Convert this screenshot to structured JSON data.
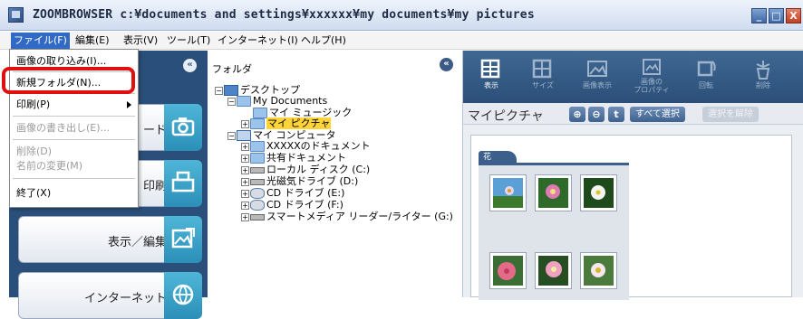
{
  "window": {
    "title": "ZOOMBROWSER c:¥documents and settings¥xxxxxx¥my documents¥my pictures",
    "minimize": "_",
    "maximize": "□",
    "close": "X"
  },
  "menubar": {
    "items": [
      "ファイル(F)",
      "編集(E)",
      "表示(V)",
      "ツール(T)",
      "インターネット(I)",
      "ヘルプ(H)"
    ]
  },
  "file_menu": {
    "items": [
      {
        "label": "画像の取り込み(I)...",
        "enabled": true
      },
      {
        "label": "新規フォルダ(N)...",
        "enabled": true,
        "highlighted": true
      },
      {
        "label": "印刷(P)",
        "enabled": true,
        "submenu": true
      },
      {
        "label": "画像の書き出し(E)...",
        "enabled": false
      },
      {
        "label": "削除(D)",
        "enabled": false
      },
      {
        "label": "名前の変更(M)",
        "enabled": false
      },
      {
        "label": "終了(X)",
        "enabled": true
      }
    ]
  },
  "task_pane": {
    "collapse": "«",
    "buttons": [
      {
        "label": "ード",
        "icon": "camera-icon"
      },
      {
        "label": "印刷",
        "icon": "printer-icon"
      },
      {
        "label": "表示／編集",
        "icon": "image-edit-icon"
      },
      {
        "label": "インターネット",
        "icon": "globe-icon"
      }
    ]
  },
  "folder_pane": {
    "title": "フォルダ",
    "collapse": "«",
    "tree": [
      {
        "label": "デスクトップ",
        "icon": "desktop"
      },
      {
        "label": "My Documents",
        "icon": "folder"
      },
      {
        "label": "マイ ミュージック",
        "icon": "folder"
      },
      {
        "label": "マイ ピクチャ",
        "icon": "folder",
        "selected": true
      },
      {
        "label": "マイ コンピュータ",
        "icon": "computer"
      },
      {
        "label": "XXXXXのドキュメント",
        "icon": "folder"
      },
      {
        "label": "共有ドキュメント",
        "icon": "folder"
      },
      {
        "label": "ローカル ディスク (C:)",
        "icon": "drive"
      },
      {
        "label": "光磁気ドライブ (D:)",
        "icon": "drive"
      },
      {
        "label": "CD ドライブ (E:)",
        "icon": "cd"
      },
      {
        "label": "CD ドライブ (F:)",
        "icon": "cd"
      },
      {
        "label": "スマートメディア リーダー/ライター (G:)",
        "icon": "drive"
      }
    ]
  },
  "toolbar": {
    "buttons": [
      {
        "label": "表示",
        "enabled": true
      },
      {
        "label": "サイズ",
        "enabled": false
      },
      {
        "label": "画像表示",
        "enabled": false
      },
      {
        "label": "画像の\nプロパティ",
        "enabled": false
      },
      {
        "label": "回転",
        "enabled": false
      },
      {
        "label": "削除",
        "enabled": false
      }
    ]
  },
  "location": {
    "title": "マイピクチャ",
    "zoom_in": "⊕",
    "zoom_out": "⊖",
    "up": "t",
    "select_all": "すべて選択",
    "deselect": "選択を解除"
  },
  "viewer": {
    "group_label": "花",
    "thumbnails": [
      "flower-1",
      "flower-2",
      "flower-3",
      "flower-4",
      "flower-5",
      "flower-6"
    ]
  }
}
